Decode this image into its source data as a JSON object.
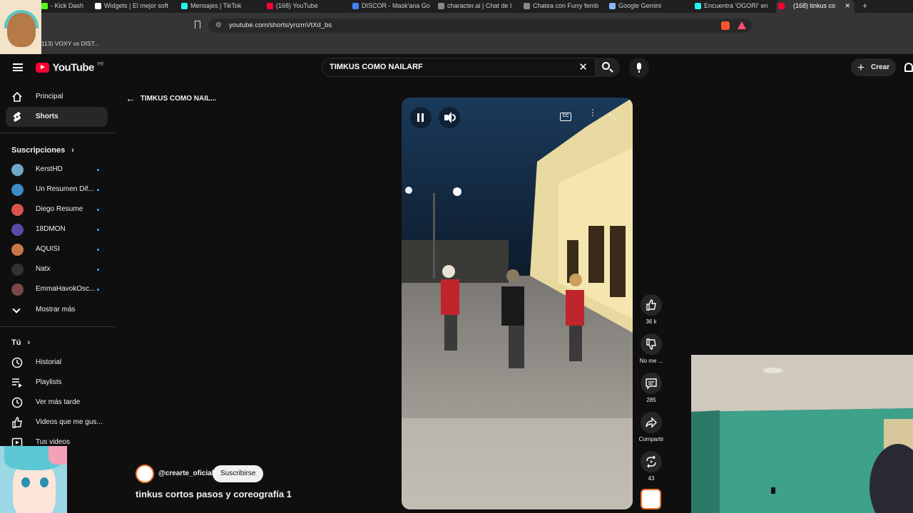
{
  "browser": {
    "tabs": [
      {
        "title": "- Kick Dash",
        "fav": "#53fc18"
      },
      {
        "title": "Widgets | El mejor soft",
        "fav": "#ffffff"
      },
      {
        "title": "Mensajes | TikTok",
        "fav": "#25f4ee"
      },
      {
        "title": "(168) YouTube",
        "fav": "#ff0033"
      },
      {
        "title": "DISCOR - Mask'ana Go",
        "fav": "#4285f4"
      },
      {
        "title": "character.ai | Chat de I",
        "fav": "#888888"
      },
      {
        "title": "Chatea con Furry femb",
        "fav": "#888888"
      },
      {
        "title": "Google Gemini",
        "fav": "#8ab4f8"
      },
      {
        "title": "Encuentra 'OGORI' en",
        "fav": "#25f4ee"
      },
      {
        "title": "(168) tinkus co",
        "fav": "#ff0033"
      }
    ],
    "url": "youtube.com/shorts/ynzmVtXd_bs",
    "bookmark": "113) VOXY vs DIST..."
  },
  "youtube": {
    "logo_text": "YouTube",
    "region": "PE",
    "search_value": "TIMKUS COMO NAILARF",
    "create_label": "Crear"
  },
  "sidebar": {
    "main": [
      {
        "label": "Principal",
        "icon": "home-icon"
      },
      {
        "label": "Shorts",
        "icon": "shorts-icon"
      }
    ],
    "subs_header": "Suscripciones",
    "subscriptions": [
      {
        "label": "KerstHD",
        "color": "#6fa8c9"
      },
      {
        "label": "Un Resumen Dif...",
        "color": "#3c8bc4"
      },
      {
        "label": "Diego Resume",
        "color": "#d9534f"
      },
      {
        "label": "18DMON",
        "color": "#5a4aa8"
      },
      {
        "label": "AQUISI",
        "color": "#c9774a"
      },
      {
        "label": "Natx",
        "color": "#333333"
      },
      {
        "label": "EmmaHavokOsc...",
        "color": "#7a4a4a"
      }
    ],
    "show_more": "Mostrar más",
    "you_header": "Tú",
    "you_items": [
      {
        "label": "Historial",
        "icon": "history-icon"
      },
      {
        "label": "Playlists",
        "icon": "playlists-icon"
      },
      {
        "label": "Ver más tarde",
        "icon": "watch-later-icon"
      },
      {
        "label": "Videos que me gus...",
        "icon": "liked-icon"
      },
      {
        "label": "Tus videos",
        "icon": "your-videos-icon"
      }
    ]
  },
  "short": {
    "back_label": "TIMKUS COMO NAIL...",
    "channel": "@crearte_oficial",
    "subscribe_label": "Suscribirse",
    "title": "tinkus cortos pasos y coreografía 1",
    "likes": "36 k",
    "dislike_label": "No me ...",
    "comments": "285",
    "share_label": "Compartir",
    "remix": "43"
  }
}
